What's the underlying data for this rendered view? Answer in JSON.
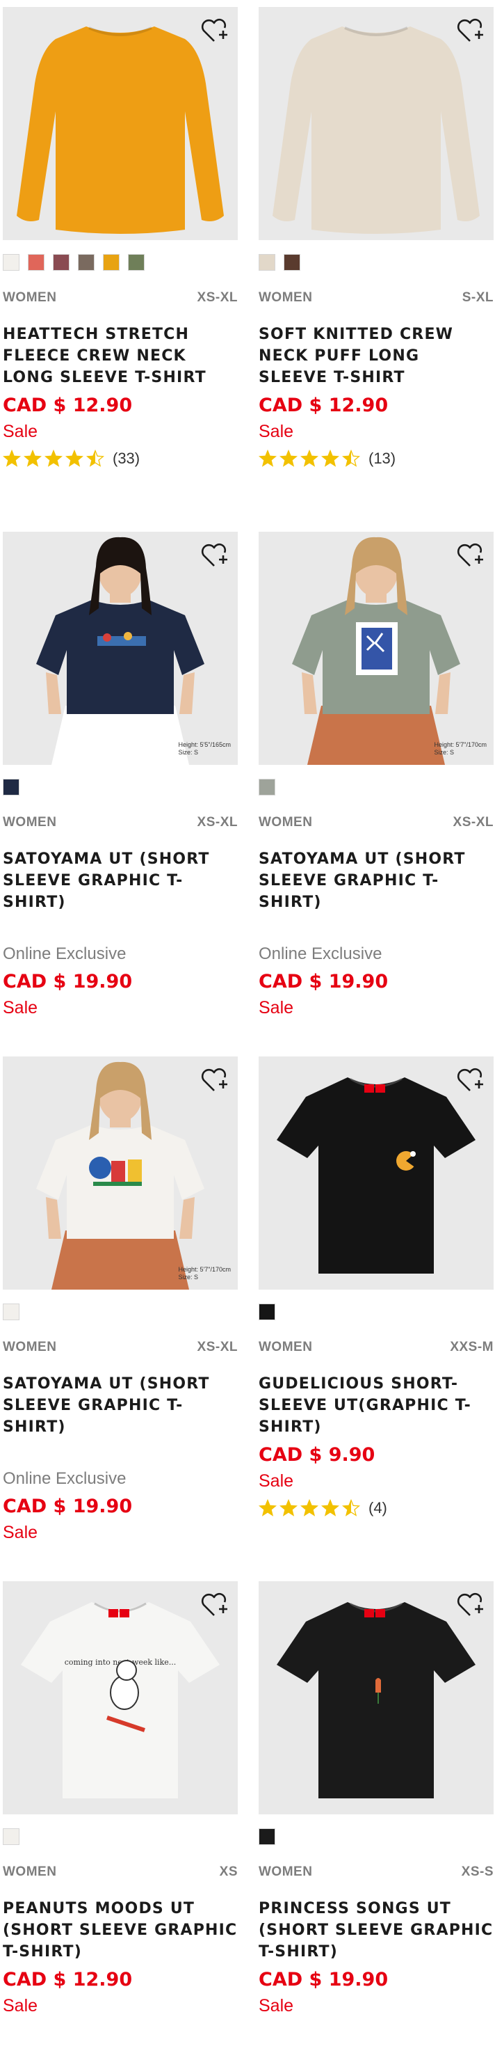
{
  "colors": {
    "accent": "#e60012",
    "star": "#f2c100"
  },
  "products": [
    {
      "gender": "WOMEN",
      "sizes": "XS-XL",
      "name": "HEATTECH STRETCH FLEECE CREW NECK LONG SLEEVE T-SHIRT",
      "exclusive": "",
      "price": "CAD $ 12.90",
      "sale": "Sale",
      "rating": 4.5,
      "reviews": "(33)",
      "swatches": [
        "#f2f0ec",
        "#e0665a",
        "#8a4b52",
        "#7a6a5f",
        "#e8a312",
        "#6f7f59"
      ],
      "image": {
        "type": "sweater",
        "color": "#ee9e14",
        "bg": "#e9e9e9",
        "fit": ""
      }
    },
    {
      "gender": "WOMEN",
      "sizes": "S-XL",
      "name": "SOFT KNITTED CREW NECK PUFF LONG SLEEVE T-SHIRT",
      "exclusive": "",
      "price": "CAD $ 12.90",
      "sale": "Sale",
      "rating": 4.5,
      "reviews": "(13)",
      "swatches": [
        "#e2d8c9",
        "#5a3b2e"
      ],
      "image": {
        "type": "sweater",
        "color": "#e5dbcc",
        "bg": "#e9e9e9",
        "fit": ""
      }
    },
    {
      "gender": "WOMEN",
      "sizes": "XS-XL",
      "name": "SATOYAMA UT (SHORT SLEEVE GRAPHIC T-SHIRT)",
      "exclusive": "Online Exclusive",
      "price": "CAD $ 19.90",
      "sale": "Sale",
      "rating": 0,
      "reviews": "",
      "swatches": [
        "#1f2a44"
      ],
      "image": {
        "type": "model",
        "color": "#1f2a44",
        "bg": "#e9e9e9",
        "fit": "Height: 5'5\"/165cm\nSize: S"
      }
    },
    {
      "gender": "WOMEN",
      "sizes": "XS-XL",
      "name": "SATOYAMA UT (SHORT SLEEVE GRAPHIC T-SHIRT)",
      "exclusive": "Online Exclusive",
      "price": "CAD $ 19.90",
      "sale": "Sale",
      "rating": 0,
      "reviews": "",
      "swatches": [
        "#9ea39a"
      ],
      "image": {
        "type": "model",
        "color": "#8f9c8e",
        "bg": "#e9e9e9",
        "fit": "Height: 5'7\"/170cm\nSize: S"
      }
    },
    {
      "gender": "WOMEN",
      "sizes": "XS-XL",
      "name": "SATOYAMA UT (SHORT SLEEVE GRAPHIC T-SHIRT)",
      "exclusive": "Online Exclusive",
      "price": "CAD $ 19.90",
      "sale": "Sale",
      "rating": 0,
      "reviews": "",
      "swatches": [
        "#f2f0ec"
      ],
      "image": {
        "type": "model",
        "color": "#f4f2ee",
        "bg": "#e9e9e9",
        "fit": "Height: 5'7\"/170cm\nSize: S"
      }
    },
    {
      "gender": "WOMEN",
      "sizes": "XXS-M",
      "name": "GUDELICIOUS SHORT-SLEEVE UT(GRAPHIC T-SHIRT)",
      "exclusive": "",
      "price": "CAD $ 9.90",
      "sale": "Sale",
      "rating": 4.5,
      "reviews": "(4)",
      "swatches": [
        "#151515"
      ],
      "image": {
        "type": "tee",
        "color": "#141414",
        "bg": "#e9e9e9",
        "fit": ""
      }
    },
    {
      "gender": "WOMEN",
      "sizes": "XS",
      "name": "PEANUTS MOODS UT (SHORT SLEEVE GRAPHIC T-SHIRT)",
      "exclusive": "",
      "price": "CAD $ 12.90",
      "sale": "Sale",
      "rating": 0,
      "reviews": "",
      "swatches": [
        "#f2f0ec"
      ],
      "image": {
        "type": "tee",
        "color": "#f6f6f4",
        "bg": "#e9e9e9",
        "fit": ""
      }
    },
    {
      "gender": "WOMEN",
      "sizes": "XS-S",
      "name": "PRINCESS SONGS UT (SHORT SLEEVE GRAPHIC T-SHIRT)",
      "exclusive": "",
      "price": "CAD $ 19.90",
      "sale": "Sale",
      "rating": 0,
      "reviews": "",
      "swatches": [
        "#1b1b1b"
      ],
      "image": {
        "type": "tee",
        "color": "#1a1a1a",
        "bg": "#e9e9e9",
        "fit": ""
      }
    }
  ]
}
